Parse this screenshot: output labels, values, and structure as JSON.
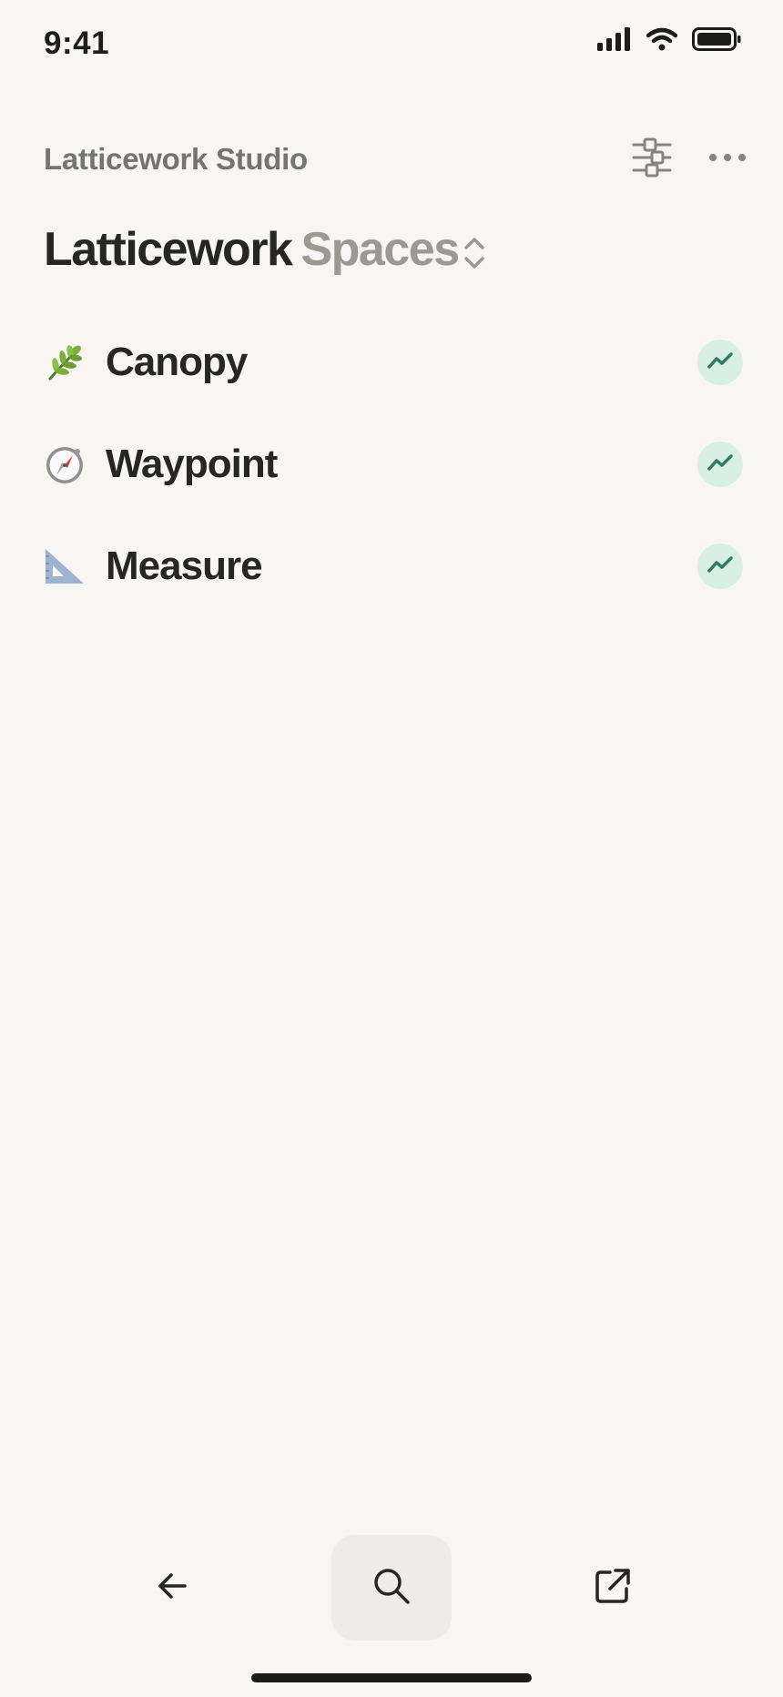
{
  "status_bar": {
    "time": "9:41",
    "icons": [
      "cellular-signal-icon",
      "wifi-icon",
      "battery-icon"
    ]
  },
  "header": {
    "workspace_name": "Latticework Studio",
    "actions": [
      "sliders-icon",
      "more-icon"
    ]
  },
  "title": {
    "main": "Latticework",
    "switch_label": "Spaces"
  },
  "spaces": [
    {
      "emoji": "🌿",
      "label": "Canopy",
      "icon": "leaf-icon",
      "badge_icon": "trend-up-icon"
    },
    {
      "emoji": "🧭",
      "label": "Waypoint",
      "icon": "compass-icon",
      "badge_icon": "trend-up-icon"
    },
    {
      "emoji": "📐",
      "label": "Measure",
      "icon": "triangle-ruler-icon",
      "badge_icon": "trend-up-icon"
    }
  ],
  "toolbar": {
    "items": [
      "back-arrow-icon",
      "search-icon",
      "open-external-icon"
    ]
  },
  "colors": {
    "background": "#f7f6f3",
    "badge_bg": "#d8efe6",
    "badge_fg": "#2e7d62",
    "muted_text": "#75756f"
  }
}
